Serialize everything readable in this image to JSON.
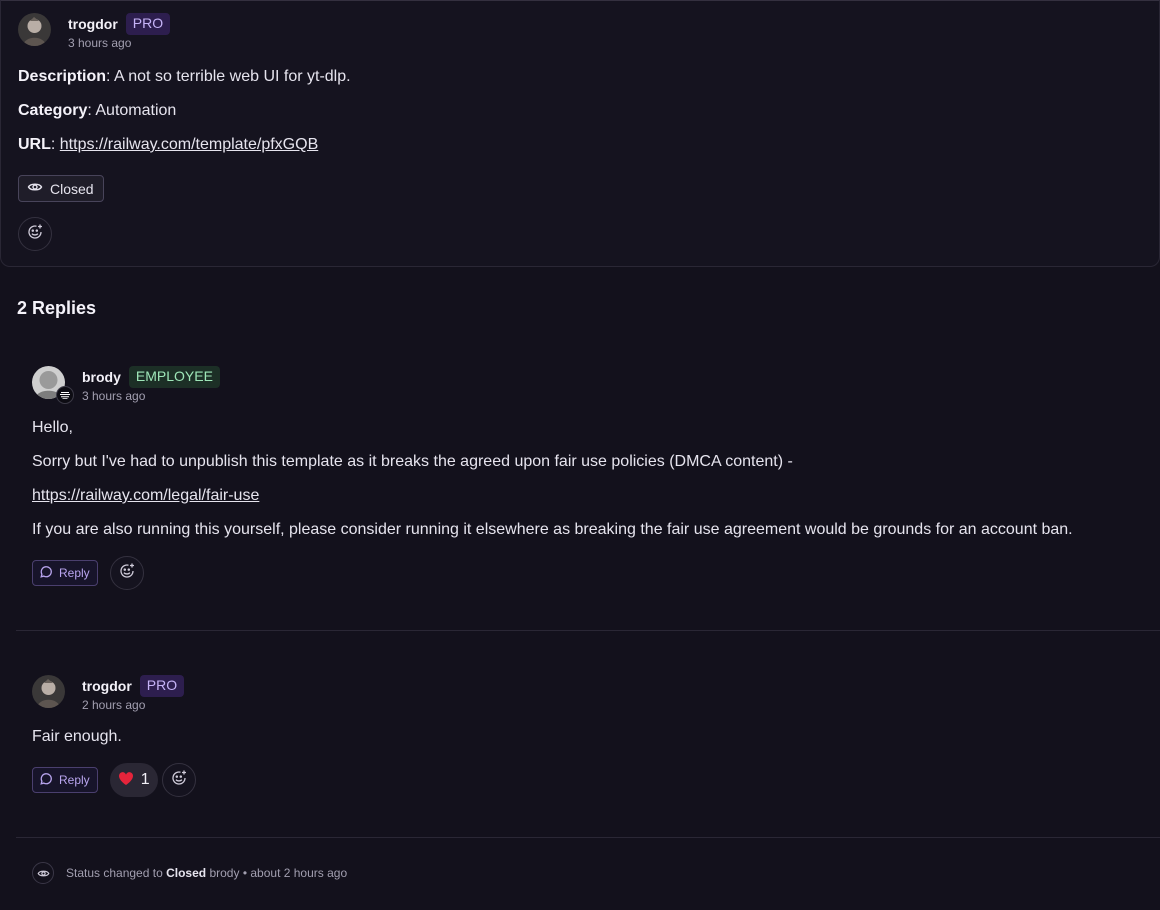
{
  "post": {
    "author": "trogdor",
    "badge": "PRO",
    "time": "3 hours ago",
    "description_key": "Description",
    "description_val": ": A not so terrible web UI for yt-dlp.",
    "category_key": "Category",
    "category_val": ": Automation",
    "url_key": "URL",
    "url_sep": ": ",
    "url_val": "https://railway.com/template/pfxGQB",
    "status_label": "Closed"
  },
  "replies_title": "2 Replies",
  "reply1": {
    "author": "brody",
    "badge": "EMPLOYEE",
    "time": "3 hours ago",
    "line1": "Hello,",
    "line2": "Sorry but I've had to unpublish this template as it breaks the agreed upon fair use policies (DMCA content) -",
    "link": "https://railway.com/legal/fair-use",
    "line3": "If you are also running this yourself, please consider running it elsewhere as breaking the fair use agreement would be grounds for an account ban.",
    "reply_label": "Reply"
  },
  "reply2": {
    "author": "trogdor",
    "badge": "PRO",
    "time": "2 hours ago",
    "line1": "Fair enough.",
    "reply_label": "Reply",
    "reaction_count": "1"
  },
  "status_change": {
    "prefix": "Status changed to",
    "status": "Closed",
    "actor": "brody",
    "sep": "•",
    "time": "about 2 hours ago"
  },
  "icons": {
    "eye": "eye-icon",
    "add_reaction": "add-reaction-icon",
    "chat": "chat-bubble-icon",
    "heart": "heart-icon"
  },
  "colors": {
    "background": "#13111c",
    "pro_badge": "#2d1e4e",
    "employee_badge": "#1c2f26",
    "reply_accent": "#b9a5ef",
    "heart": "#e5243b"
  }
}
